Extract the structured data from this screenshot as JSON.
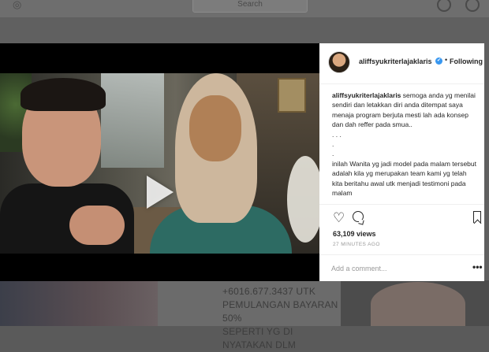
{
  "background": {
    "search_placeholder": "Search",
    "promo_text": "+6016.677.3437 UTK\nPEMULANGAN BAYARAN 50%\nSEPERTI YG DI NYATAKAN DLM"
  },
  "post": {
    "username": "aliffsyukriterlajaklaris",
    "verified_glyph": "✔",
    "separator": "•",
    "follow_label": "Following",
    "caption_user": "aliffsyukriterlajaklaris",
    "caption_text": " semoga anda yg menilai sendiri dan letakkan diri anda ditempat saya menaja program berjuta mesti lah ada konsep dan dah reffer pada smua..\n. . .\n.\n.\ninilah Wanita yg jadi model pada malam tersebut adalah kila yg merupakan team kami yg telah kita beritahu awal utk menjadi testimoni pada malam",
    "views": "63,109 views",
    "timestamp": "27 MINUTES AGO",
    "comment_placeholder": "Add a comment...",
    "more_glyph": "•••",
    "heart_glyph": "♡"
  },
  "colors": {
    "accent": "#3897f0",
    "text": "#262626",
    "muted": "#999999"
  }
}
